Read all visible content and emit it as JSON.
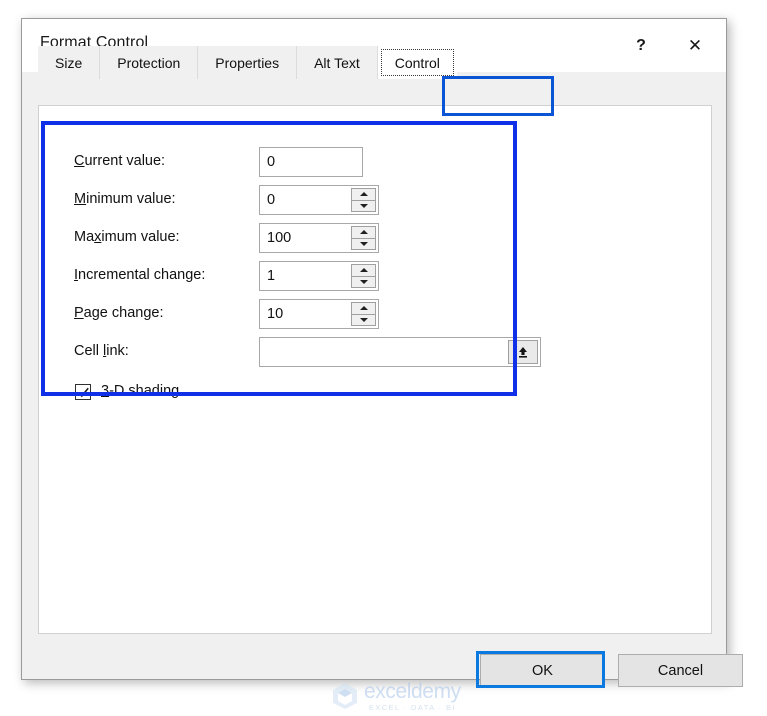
{
  "dialog": {
    "title": "Format Control",
    "help_label": "?",
    "close_label": "✕"
  },
  "tabs": [
    {
      "label": "Size",
      "selected": false
    },
    {
      "label": "Protection",
      "selected": false
    },
    {
      "label": "Properties",
      "selected": false
    },
    {
      "label": "Alt Text",
      "selected": false
    },
    {
      "label": "Control",
      "selected": true
    }
  ],
  "form": {
    "rows": [
      {
        "label_pre": "",
        "label_key": "C",
        "label_post": "urrent value:",
        "value": "0",
        "spinner": false,
        "picker": false,
        "width": "narrow"
      },
      {
        "label_pre": "",
        "label_key": "M",
        "label_post": "inimum value:",
        "value": "0",
        "spinner": true,
        "picker": false,
        "width": "spin"
      },
      {
        "label_pre": "Ma",
        "label_key": "x",
        "label_post": "imum value:",
        "value": "100",
        "spinner": true,
        "picker": false,
        "width": "spin"
      },
      {
        "label_pre": "",
        "label_key": "I",
        "label_post": "ncremental change:",
        "value": "1",
        "spinner": true,
        "picker": false,
        "width": "spin"
      },
      {
        "label_pre": "",
        "label_key": "P",
        "label_post": "age change:",
        "value": "10",
        "spinner": true,
        "picker": false,
        "width": "spin"
      },
      {
        "label_pre": "Cell ",
        "label_key": "l",
        "label_post": "ink:",
        "value": "",
        "spinner": false,
        "picker": true,
        "width": "wide"
      }
    ],
    "checkbox": {
      "label_pre": "",
      "label_key": "3",
      "label_post": "-D shading",
      "checked": true
    }
  },
  "footer": {
    "ok_label": "OK",
    "cancel_label": "Cancel"
  },
  "watermark": {
    "name": "exceldemy",
    "subtitle": "EXCEL · DATA · BI"
  },
  "colors": {
    "annotation_blue": "#1030e8",
    "ok_highlight_blue": "#0a7ae0",
    "tab_highlight_blue": "#0a54d6",
    "dialog_bg": "#f0f0f0",
    "panel_bg": "#ffffff"
  }
}
